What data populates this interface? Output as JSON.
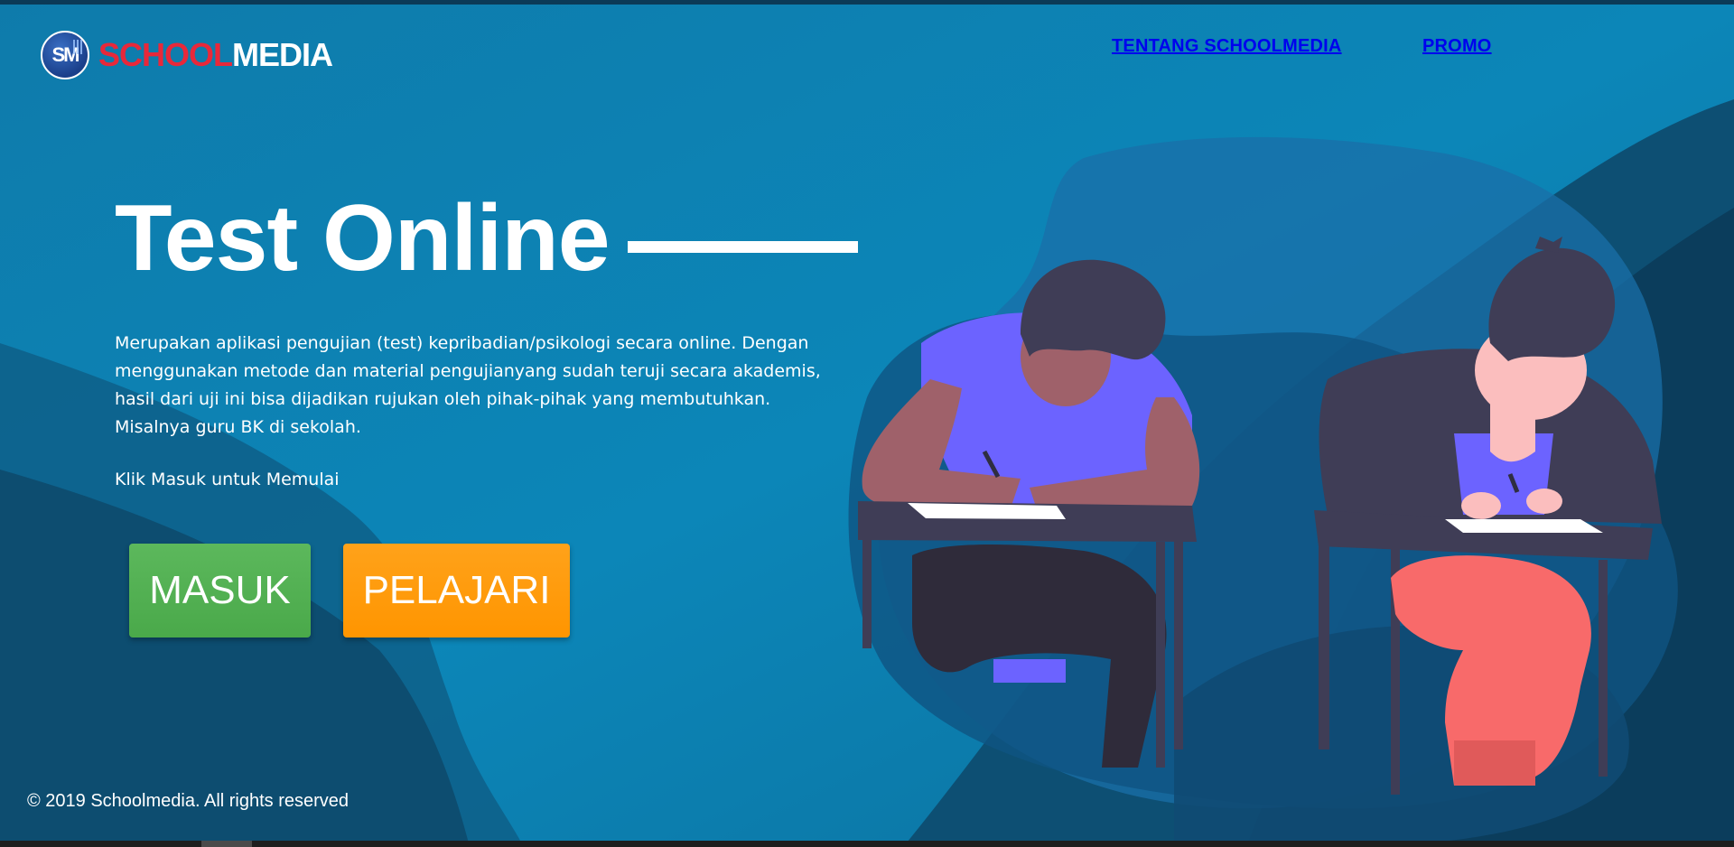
{
  "brand": {
    "badge": "SM",
    "name_part1": "SCHOOL",
    "name_part2": "MEDIA"
  },
  "nav": {
    "items": [
      {
        "label": "TENTANG SCHOOLMEDIA"
      },
      {
        "label": "PROMO"
      }
    ]
  },
  "hero": {
    "title": "Test Online",
    "description": "Merupakan aplikasi pengujian (test) kepribadian/psikologi secara online. Dengan menggunakan metode dan material pengujianyang sudah teruji secara akademis, hasil dari uji ini bisa dijadikan rujukan oleh pihak-pihak yang membutuhkan. Misalnya guru BK di sekolah.",
    "cta_text": "Klik Masuk untuk Memulai",
    "buttons": {
      "login": "MASUK",
      "learn": "PELAJARI"
    }
  },
  "footer": {
    "copyright": "© 2019 Schoolmedia. All rights reserved"
  },
  "colors": {
    "background_top": "#0c85b8",
    "background_dark": "#0b3a57",
    "brand_red": "#e8283a",
    "button_green": "#5cb85c",
    "button_orange": "#ff9800",
    "shirt_purple": "#6c63ff",
    "pants_coral": "#f86a6a"
  }
}
